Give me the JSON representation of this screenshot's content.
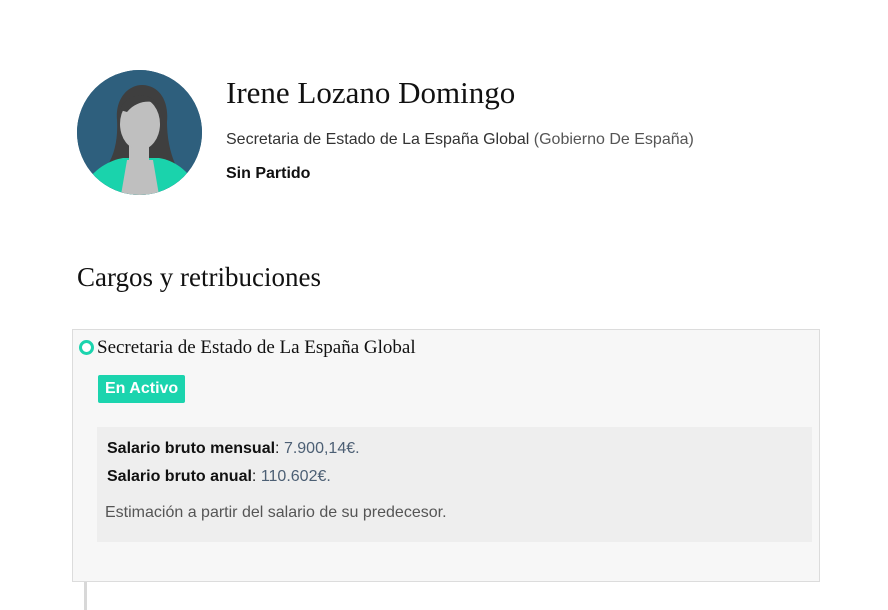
{
  "profile": {
    "name": "Irene Lozano Domingo",
    "role": "Secretaria de Estado de La España Global",
    "government": "(Gobierno De España)",
    "party": "Sin Partido",
    "avatar_icon": "person-placeholder-icon"
  },
  "section": {
    "title": "Cargos y retribuciones"
  },
  "position": {
    "title": "Secretaria de Estado de La España Global",
    "status": "En Activo",
    "monthly_label": "Salario bruto mensual",
    "monthly_value": "7.900,14€.",
    "annual_label": "Salario bruto anual",
    "annual_value": "110.602€.",
    "note": "Estimación a partir del salario de su predecesor."
  },
  "colors": {
    "accent": "#1bd4ae",
    "avatar_bg": "#2e5f7d",
    "value_text": "#4c5f74"
  }
}
